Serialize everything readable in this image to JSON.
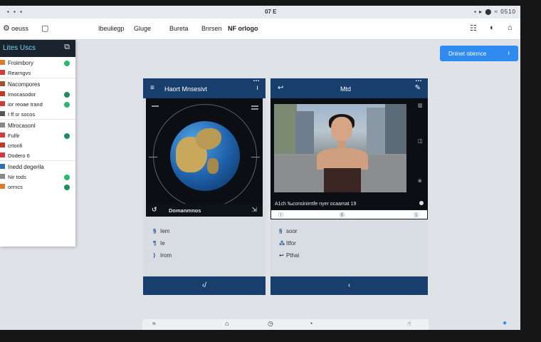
{
  "status_bar": {
    "left": "▪ ▪ ▪",
    "center": "07 E",
    "right": "▪ ▸ ⬤ ≈ 0510"
  },
  "app_header": {
    "left_icon": "settings-icon",
    "left_label": "oeuss",
    "menu": [
      "Ibeuliegp",
      "Gluge",
      "Bureta",
      "Bnrsen",
      "NF orlogo"
    ],
    "right_icons": [
      "filter-icon",
      "refresh-icon",
      "lock-icon"
    ]
  },
  "sidebar": {
    "title": "Lites Uscs",
    "items": [
      {
        "label": "Froimbory",
        "color": "#e07a2a",
        "dot": "#2bb673",
        "section": true,
        "prefix": "S"
      },
      {
        "label": "Rearngvs",
        "color": "#d23b3b",
        "dot": "",
        "prefix": "ll"
      },
      {
        "label": "Nacompores",
        "color": "#a0522d",
        "dot": "",
        "section": true,
        "prefix": "H"
      },
      {
        "label": "Imocasodor",
        "color": "#c0392b",
        "dot": "#1f8e5a",
        "prefix": "P"
      },
      {
        "label": "ior reoae trand",
        "color": "#d23b3b",
        "dot": "#2bb673",
        "prefix": ""
      },
      {
        "label": "I ff sr socos",
        "color": "#555555",
        "dot": "",
        "prefix": "T"
      },
      {
        "label": "Mlrocasonl",
        "color": "#888888",
        "dot": "",
        "section": true,
        "prefix": "I"
      },
      {
        "label": "Fulfir",
        "color": "#d23b3b",
        "dot": "#1f8e5a",
        "prefix": ""
      },
      {
        "label": "crtonfi",
        "color": "#c0392b",
        "dot": "",
        "prefix": ""
      },
      {
        "label": "Dodero 6",
        "color": "#d23b3b",
        "dot": "",
        "prefix": "S"
      },
      {
        "label": "Inedd degerila",
        "color": "#2f6fb0",
        "dot": "",
        "section": true,
        "prefix": "H"
      },
      {
        "label": "Nir tods",
        "color": "#888888",
        "dot": "#2bb673",
        "prefix": ""
      },
      {
        "label": "orrncs",
        "color": "#e07a2a",
        "dot": "#1f8e5a",
        "prefix": ""
      }
    ]
  },
  "sync_button": {
    "label": "Dninet obinnce",
    "icon": "info-icon"
  },
  "panel_left": {
    "title": "Haort Mnsesivt",
    "view_label": "Domanmnos",
    "view_icon": "globe-icon",
    "list": [
      {
        "glyph": "§",
        "label": "Iem"
      },
      {
        "glyph": "¶",
        "label": "Ie"
      },
      {
        "glyph": "⟩",
        "label": "Irom"
      }
    ],
    "footer_icon": "back-icon",
    "footer_label": "‹/"
  },
  "panel_right": {
    "title": "Mtd",
    "caption": "A1ch ‰consinimtfe nyer ocaamat 19",
    "controls": [
      "Ⓘ",
      "Ⓡ",
      "Ⓢ"
    ],
    "list": [
      {
        "glyph": "§",
        "label": "soor"
      },
      {
        "glyph": "⁂",
        "label": "Itfor"
      },
      {
        "glyph": "↩",
        "label": "Pthai"
      }
    ],
    "footer_icon": "chevron-left-icon",
    "footer_label": "‹"
  },
  "bottom_toolbar": {
    "icons": [
      "wifi-icon",
      "home-icon",
      "clock-icon",
      "bell-icon",
      "hand-icon"
    ]
  }
}
